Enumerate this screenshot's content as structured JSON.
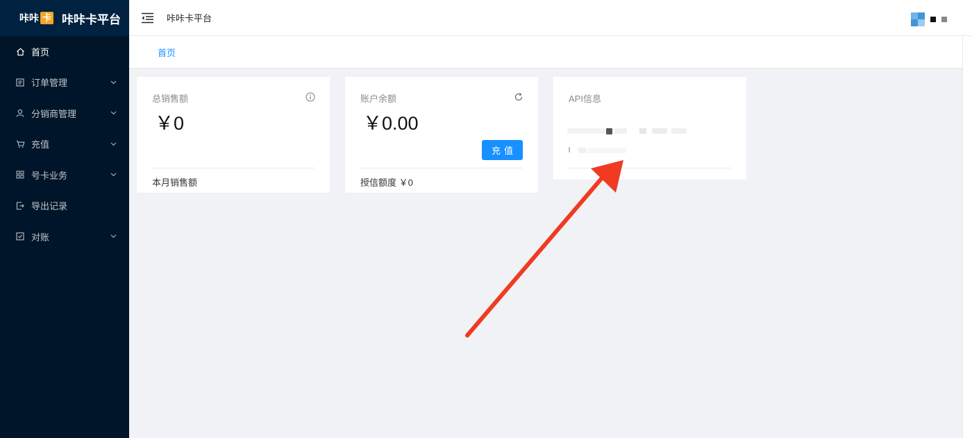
{
  "brand": {
    "logo_text": "咔咔",
    "logo_badge": "卡",
    "title": "咔咔卡平台"
  },
  "sidebar": {
    "items": [
      {
        "label": "首页",
        "icon": "home-icon",
        "has_submenu": false,
        "active": true
      },
      {
        "label": "订单管理",
        "icon": "list-icon",
        "has_submenu": true
      },
      {
        "label": "分销商管理",
        "icon": "user-icon",
        "has_submenu": true
      },
      {
        "label": "充值",
        "icon": "cart-icon",
        "has_submenu": true
      },
      {
        "label": "号卡业务",
        "icon": "grid-icon",
        "has_submenu": true
      },
      {
        "label": "导出记录",
        "icon": "export-icon",
        "has_submenu": false
      },
      {
        "label": "对账",
        "icon": "reconcile-icon",
        "has_submenu": true
      }
    ]
  },
  "header": {
    "title": "咔咔卡平台"
  },
  "tabs": {
    "home": "首页"
  },
  "cards": {
    "sales": {
      "title": "总销售额",
      "value": "￥0",
      "footer": "本月销售额",
      "icon": "info-icon"
    },
    "balance": {
      "title": "账户余额",
      "value": "￥0.00",
      "button": "充值",
      "footer": "授信额度 ￥0",
      "icon": "refresh-icon"
    },
    "api": {
      "title": "API信息"
    }
  },
  "colors": {
    "sidebar_bg": "#001529",
    "accent": "#1890ff",
    "arrow": "#f03a22",
    "logo_badge": "#f5a623"
  }
}
